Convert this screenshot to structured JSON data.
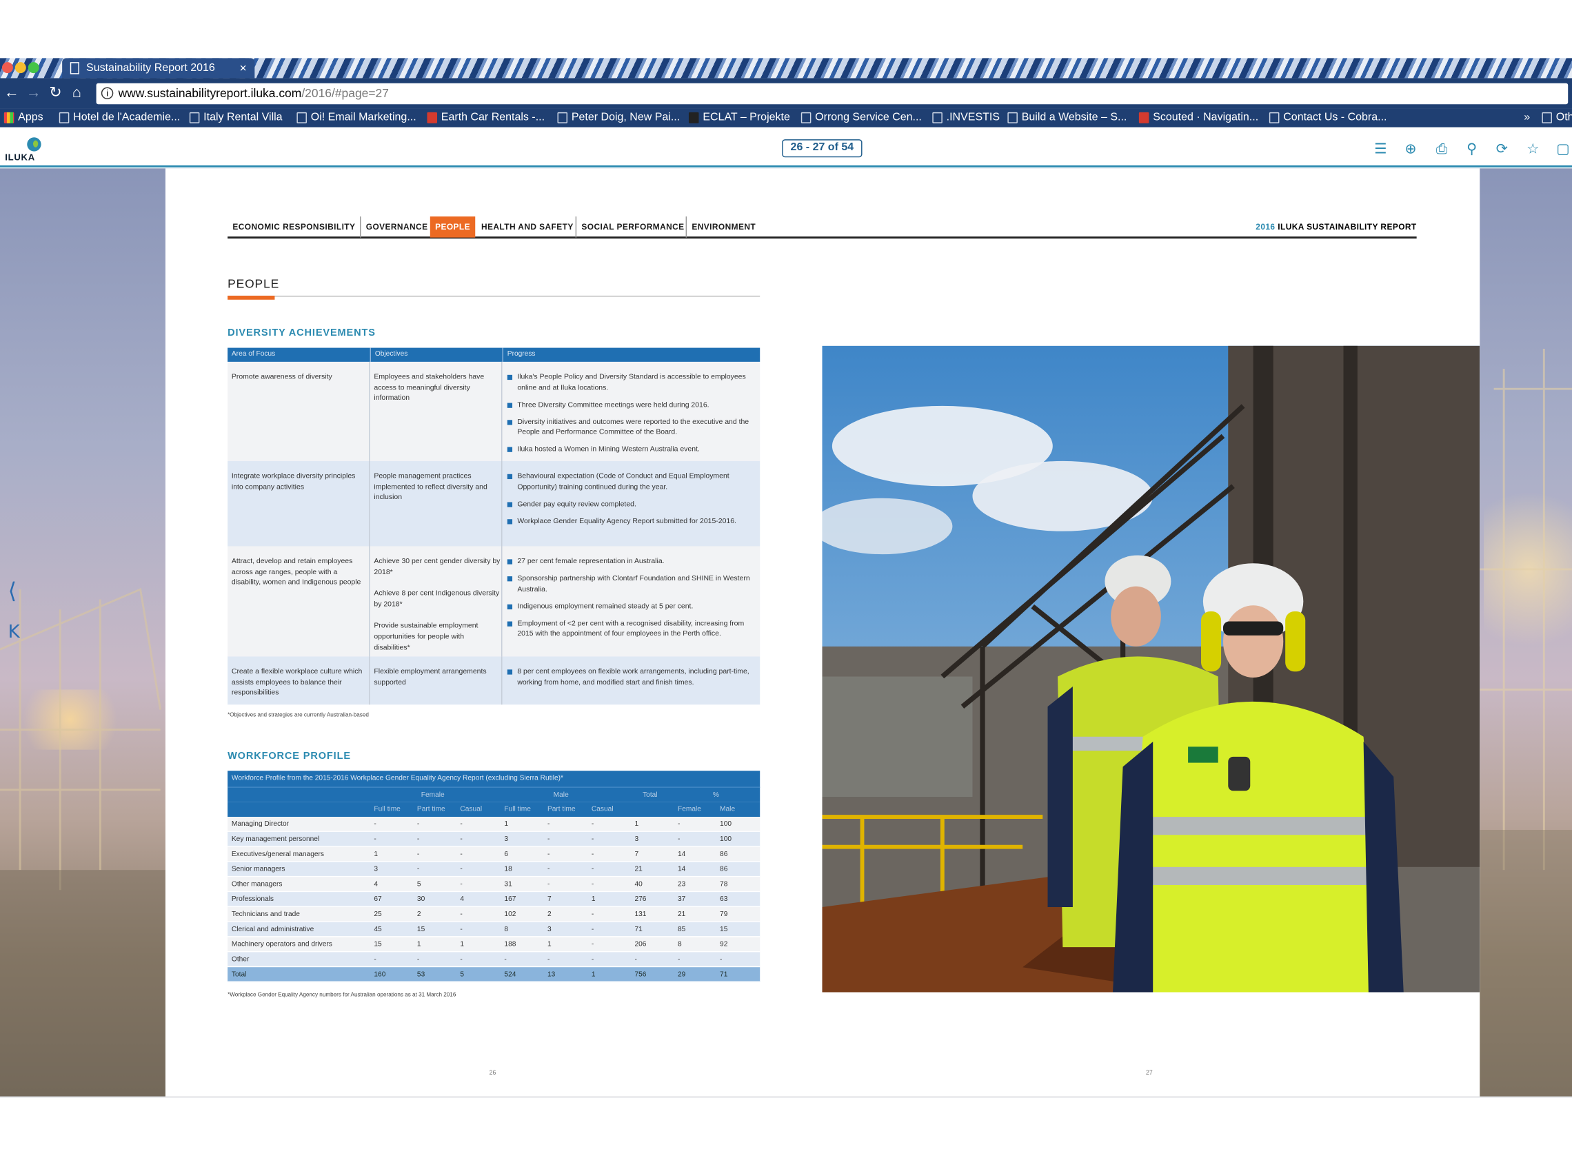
{
  "browser": {
    "tab_title": "Sustainability Report 2016",
    "tab_close": "×",
    "url_host": "www.sustainabilityreport.iluka.com",
    "url_path": "/2016/#page=27",
    "bookmarks": [
      "Apps",
      "Hotel de l'Academie...",
      "Italy Rental Villa",
      "Oi! Email Marketing...",
      "Earth Car Rentals -...",
      "Peter Doig, New Pai...",
      "ECLAT – Projekte",
      "Orrong Service Cen...",
      ".INVESTIS",
      "Build a Website – S...",
      "Scouted · Navigatin...",
      "Contact Us - Cobra...",
      "»",
      "Oth"
    ]
  },
  "viewer": {
    "logo_text": "ILUKA",
    "page_indicator": "26 - 27 of 54"
  },
  "nav": {
    "items": [
      "ECONOMIC RESPONSIBILITY",
      "GOVERNANCE",
      "PEOPLE",
      "HEALTH AND SAFETY",
      "SOCIAL PERFORMANCE",
      "ENVIRONMENT"
    ],
    "active": "PEOPLE",
    "report_year": "2016",
    "report_title": "ILUKA SUSTAINABILITY REPORT"
  },
  "page": {
    "title": "PEOPLE",
    "diversity_heading": "DIVERSITY ACHIEVEMENTS",
    "workforce_heading": "WORKFORCE PROFILE",
    "left_page_number": "26",
    "right_page_number": "27"
  },
  "diversity": {
    "headers": [
      "Area of Focus",
      "Objectives",
      "Progress"
    ],
    "rows": [
      {
        "area": "Promote awareness of diversity",
        "objectives": [
          "Employees and stakeholders have access to meaningful diversity information"
        ],
        "progress": [
          "Iluka's People Policy and Diversity Standard is accessible to employees online and at Iluka locations.",
          "Three Diversity Committee meetings were held during 2016.",
          "Diversity initiatives and outcomes were reported to the executive and the People and Performance Committee of the Board.",
          "Iluka hosted a Women in Mining Western Australia event."
        ]
      },
      {
        "area": "Integrate workplace diversity principles into company activities",
        "objectives": [
          "People management practices implemented to reflect diversity and inclusion"
        ],
        "progress": [
          "Behavioural expectation (Code of Conduct and Equal Employment Opportunity) training continued during the year.",
          "Gender pay equity review completed.",
          "Workplace Gender Equality Agency Report submitted for 2015-2016."
        ]
      },
      {
        "area": "Attract, develop and retain employees across age ranges, people with a disability, women and Indigenous people",
        "objectives": [
          "Achieve 30 per cent gender diversity by 2018*",
          "Achieve 8 per cent Indigenous diversity by 2018*",
          "Provide sustainable employment opportunities for people with disabilities*"
        ],
        "progress": [
          "27 per cent female representation in Australia.",
          "Sponsorship partnership with Clontarf Foundation and SHINE in Western Australia.",
          "Indigenous employment remained steady at 5 per cent.",
          "Employment of <2 per cent with a recognised disability, increasing from 2015 with the appointment of four employees in the Perth office."
        ]
      },
      {
        "area": "Create a flexible workplace culture which assists employees to balance their responsibilities",
        "objectives": [
          "Flexible employment arrangements supported"
        ],
        "progress": [
          "8 per cent employees on flexible work arrangements, including part-time, working from home, and modified start and finish times."
        ]
      }
    ],
    "footnote": "*Objectives and strategies are currently Australian-based"
  },
  "workforce": {
    "caption": "Workforce Profile from the 2015-2016 Workplace Gender Equality Agency Report (excluding Sierra Rutile)*",
    "group_headers": [
      "Female",
      "Male",
      "Total",
      "%"
    ],
    "sub_headers": [
      "Full time",
      "Part time",
      "Casual",
      "Full time",
      "Part time",
      "Casual",
      "Female",
      "Male"
    ],
    "rows": [
      [
        "Managing Director",
        "-",
        "-",
        "-",
        "1",
        "-",
        "-",
        "1",
        "-",
        "100"
      ],
      [
        "Key management personnel",
        "-",
        "-",
        "-",
        "3",
        "-",
        "-",
        "3",
        "-",
        "100"
      ],
      [
        "Executives/general managers",
        "1",
        "-",
        "-",
        "6",
        "-",
        "-",
        "7",
        "14",
        "86"
      ],
      [
        "Senior managers",
        "3",
        "-",
        "-",
        "18",
        "-",
        "-",
        "21",
        "14",
        "86"
      ],
      [
        "Other managers",
        "4",
        "5",
        "-",
        "31",
        "-",
        "-",
        "40",
        "23",
        "78"
      ],
      [
        "Professionals",
        "67",
        "30",
        "4",
        "167",
        "7",
        "1",
        "276",
        "37",
        "63"
      ],
      [
        "Technicians and trade",
        "25",
        "2",
        "-",
        "102",
        "2",
        "-",
        "131",
        "21",
        "79"
      ],
      [
        "Clerical and administrative",
        "45",
        "15",
        "-",
        "8",
        "3",
        "-",
        "71",
        "85",
        "15"
      ],
      [
        "Machinery operators and drivers",
        "15",
        "1",
        "1",
        "188",
        "1",
        "-",
        "206",
        "8",
        "92"
      ],
      [
        "Other",
        "-",
        "-",
        "-",
        "-",
        "-",
        "-",
        "-",
        "-",
        "-"
      ]
    ],
    "total": [
      "Total",
      "160",
      "53",
      "5",
      "524",
      "13",
      "1",
      "756",
      "29",
      "71"
    ],
    "footnote": "*Workplace Gender Equality Agency numbers for Australian operations as at 31 March 2016"
  },
  "colors": {
    "accent_orange": "#ec6a23",
    "table_blue": "#1f6fb2",
    "heading_teal": "#2b8ab0"
  }
}
